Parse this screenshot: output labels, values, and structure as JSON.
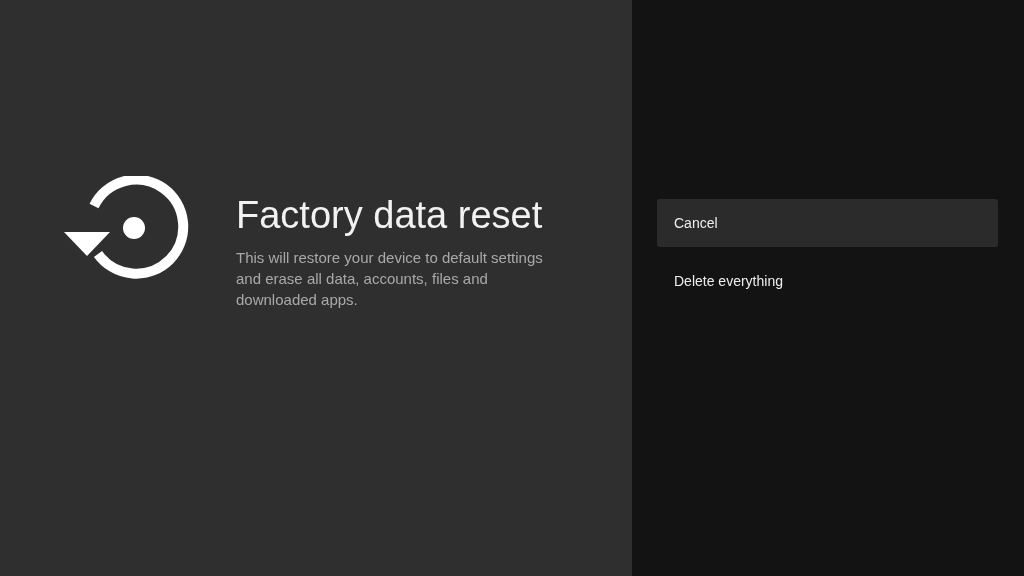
{
  "title": "Factory data reset",
  "description": "This will restore your device to default settings and erase all data, accounts, files and downloaded apps.",
  "options": [
    {
      "label": "Cancel",
      "selected": true
    },
    {
      "label": "Delete everything",
      "selected": false
    }
  ]
}
